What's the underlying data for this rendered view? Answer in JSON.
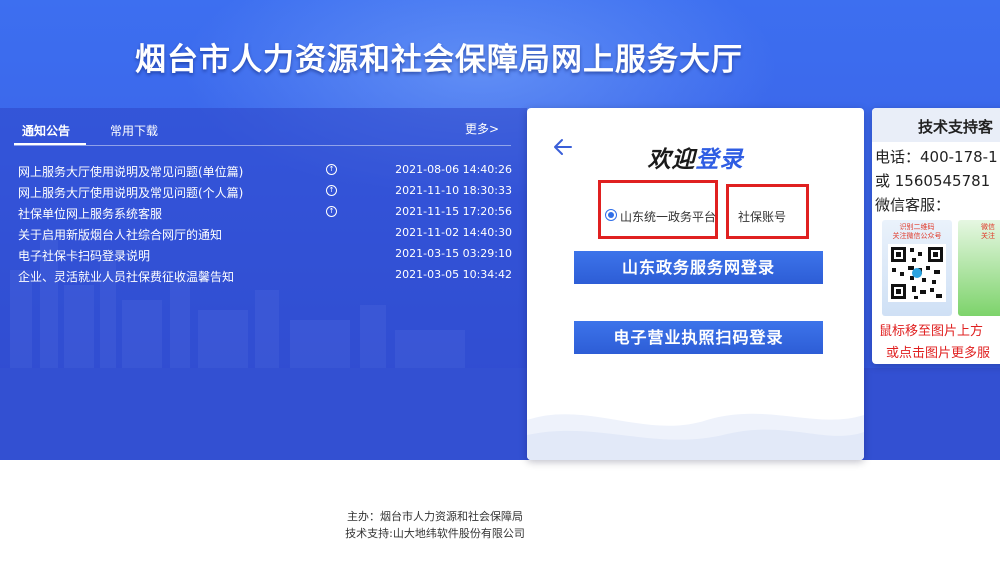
{
  "site": {
    "title": "烟台市人力资源和社会保障局网上服务大厅"
  },
  "notices": {
    "tabs": [
      {
        "label": "通知公告",
        "active": true
      },
      {
        "label": "常用下载",
        "active": false
      }
    ],
    "more": "更多>",
    "items": [
      {
        "title": "网上服务大厅使用说明及常见问题(单位篇)",
        "date": "2021-08-06 14:40:26",
        "hot": true
      },
      {
        "title": "网上服务大厅使用说明及常见问题(个人篇)",
        "date": "2021-11-10 18:30:33",
        "hot": true
      },
      {
        "title": "社保单位网上服务系统客服",
        "date": "2021-11-15 17:20:56",
        "hot": true
      },
      {
        "title": "关于启用新版烟台人社综合网厅的通知",
        "date": "2021-11-02 14:40:30",
        "hot": false
      },
      {
        "title": "电子社保卡扫码登录说明",
        "date": "2021-03-15 03:29:10",
        "hot": false
      },
      {
        "title": "企业、灵活就业人员社保费征收温馨告知",
        "date": "2021-03-05 10:34:42",
        "hot": false
      }
    ]
  },
  "login": {
    "welcome_a": "欢迎",
    "welcome_b": "登录",
    "option_platform": "山东统一政务平台",
    "option_account": "社保账号",
    "btn_gov": "山东政务服务网登录",
    "btn_license": "电子营业执照扫码登录"
  },
  "support": {
    "title": "技术支持客",
    "phone": "电话：400-178-1",
    "or_phone": "或  1560545781",
    "wechat": "微信客服：",
    "qr1_caption": "识别二维码\n关注微信公众号",
    "qr2_caption": "微信\n关注",
    "hint1": "鼠标移至图片上方",
    "hint2": "或点击图片更多服"
  },
  "footer": {
    "host": "主办：烟台市人力资源和社会保障局",
    "tech": "技术支持:山大地纬软件股份有限公司"
  },
  "colors": {
    "banner": "#3a63e8",
    "accent": "#2f5de3",
    "highlight_red": "#e02020"
  }
}
